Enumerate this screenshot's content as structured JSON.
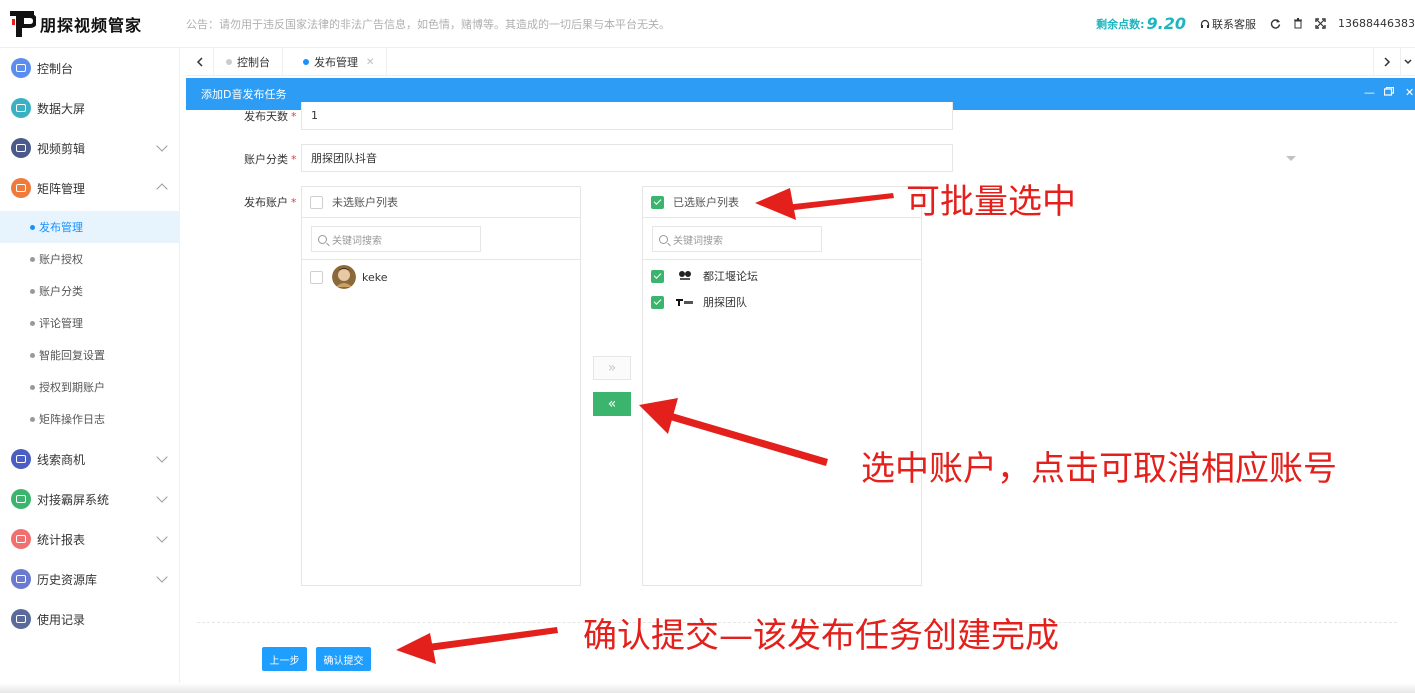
{
  "header": {
    "brand": "朋探视频管家",
    "notice": "公告：请勿用于违反国家法律的非法广告信息，如色情，赌博等。其造成的一切后果与本平台无关。",
    "points_label": "剩余点数:",
    "points_value": "9.20",
    "service": "联系客服",
    "phone": "13688446383"
  },
  "sidebar": {
    "items": [
      {
        "label": "控制台",
        "color": "#5b8def"
      },
      {
        "label": "数据大屏",
        "color": "#3ab0c3"
      },
      {
        "label": "视频剪辑",
        "color": "#4a5a8a"
      },
      {
        "label": "矩阵管理",
        "color": "#f07a3a"
      },
      {
        "label": "线索商机",
        "color": "#4a5fc1"
      },
      {
        "label": "对接霸屏系统",
        "color": "#3bb56d"
      },
      {
        "label": "统计报表",
        "color": "#f07070"
      },
      {
        "label": "历史资源库",
        "color": "#6a7bcf"
      },
      {
        "label": "使用记录",
        "color": "#5a6a9a"
      }
    ],
    "sub_items": [
      "发布管理",
      "账户授权",
      "账户分类",
      "评论管理",
      "智能回复设置",
      "授权到期账户",
      "矩阵操作日志"
    ]
  },
  "tabs": {
    "items": [
      "控制台",
      "发布管理"
    ]
  },
  "dialog": {
    "title": "添加D音发布任务"
  },
  "form": {
    "days_label": "发布天数",
    "days_value": "1",
    "category_label": "账户分类",
    "category_value": "朋探团队抖音",
    "accounts_label": "发布账户",
    "left_title": "未选账户列表",
    "right_title": "已选账户列表",
    "search_placeholder": "关键词搜索",
    "left_accounts": [
      "keke"
    ],
    "right_accounts": [
      "都江堰论坛",
      "朋探团队"
    ],
    "btn_right": "»",
    "btn_left": "«",
    "prev_button": "上一步",
    "submit_button": "确认提交"
  },
  "annotations": {
    "batch": "可批量选中",
    "cancel": "选中账户，点击可取消相应账号",
    "submit": "确认提交—该发布任务创建完成"
  }
}
